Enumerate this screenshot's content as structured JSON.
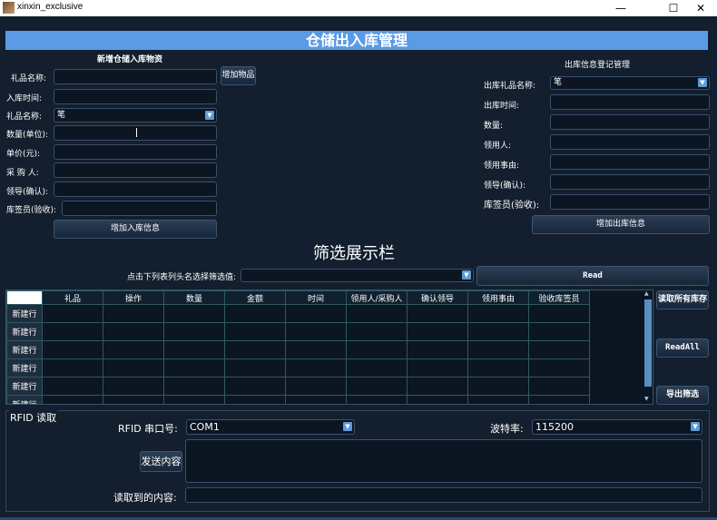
{
  "window": {
    "title": "xinxin_exclusive",
    "controls": [
      "—",
      "☐",
      "✕"
    ]
  },
  "banner": "仓储出入库管理",
  "inbound": {
    "header": "新增仓储入库物资",
    "gift_name_label": "礼品名称:",
    "add_item_button": "增加物品",
    "in_time_label": "入库时间:",
    "gift_select_label": "礼品名称:",
    "gift_select_value": "笔",
    "quantity_label": "数量(单位):",
    "unit_price_label": "单价(元):",
    "buyer_label": "采 购 人:",
    "leader_label": "领导(确认):",
    "keeper_label": "库签员(验收):",
    "add_in_button": "增加入库信息"
  },
  "outbound": {
    "header": "出库信息登记管理",
    "gift_name_label": "出库礼品名称:",
    "gift_name_value": "笔",
    "out_time_label": "出库时间:",
    "quantity_label": "数量:",
    "receiver_label": "领用人:",
    "reason_label": "领用事由:",
    "leader_label": "领导(确认):",
    "keeper_label": "库签员(验收):",
    "add_out_button": "增加出库信息"
  },
  "filter": {
    "title": "筛选展示栏",
    "prompt": "点击下列表列头名选择筛选值:",
    "combo_value": "",
    "read_button": "Read"
  },
  "table": {
    "columns": [
      "礼品",
      "操作",
      "数量",
      "金额",
      "时间",
      "领用人/采购人",
      "确认领导",
      "领用事由",
      "验收库签员"
    ],
    "row_header": "新建行",
    "row_count": 6
  },
  "side_buttons": {
    "read_all_stock": "读取所有库存",
    "read_all": "ReadAll",
    "export_filter": "导出筛选"
  },
  "rfid": {
    "group_title": "RFID 读取",
    "port_label": "RFID 串口号:",
    "port_value": "COM1",
    "baud_label": "波特率:",
    "baud_value": "115200",
    "send_button": "发送内容",
    "send_text": "",
    "read_label": "读取到的内容:",
    "read_value": ""
  }
}
